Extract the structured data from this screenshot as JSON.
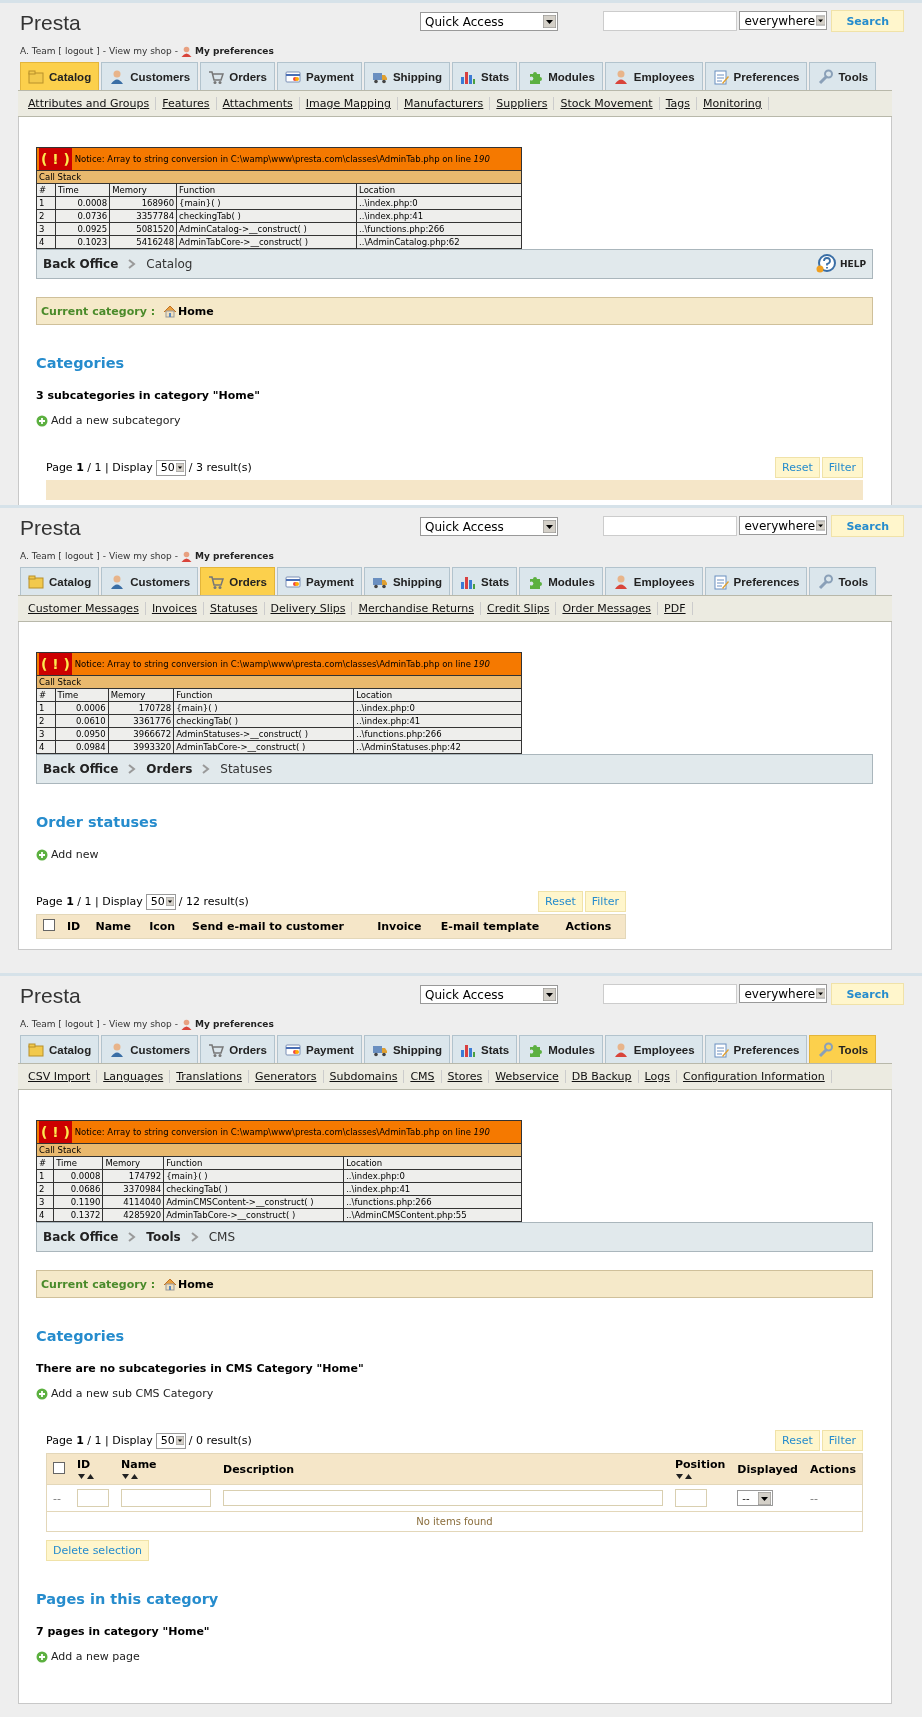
{
  "screens": [
    {
      "logo": "Presta",
      "quick_access": "Quick Access",
      "search": {
        "scope": "everywhere",
        "button": "Search"
      },
      "user": {
        "name": "A. Team [",
        "logout": "logout",
        "mid": "] -",
        "shop": "View my shop",
        "dash": "-",
        "preferences": "My preferences"
      },
      "tabs": [
        {
          "label": "Catalog",
          "selected": true
        },
        {
          "label": "Customers",
          "selected": false
        },
        {
          "label": "Orders",
          "selected": false
        },
        {
          "label": "Payment",
          "selected": false
        },
        {
          "label": "Shipping",
          "selected": false
        },
        {
          "label": "Stats",
          "selected": false
        },
        {
          "label": "Modules",
          "selected": false
        },
        {
          "label": "Employees",
          "selected": false
        },
        {
          "label": "Preferences",
          "selected": false
        },
        {
          "label": "Tools",
          "selected": false
        }
      ],
      "subtabs": [
        "Attributes and Groups",
        "Features",
        "Attachments",
        "Image Mapping",
        "Manufacturers",
        "Suppliers",
        "Stock Movement",
        "Tags",
        "Monitoring"
      ],
      "notice": {
        "icon": "( ! )",
        "message": "Notice: Array to string conversion in C:\\wamp\\www\\presta.com\\classes\\AdminTab.php on line *190*",
        "stack_title": "Call Stack",
        "columns": [
          "#",
          "Time",
          "Memory",
          "Function",
          "Location"
        ],
        "rows": [
          [
            "1",
            "0.0008",
            "168960",
            "{main}( )",
            "..\\index.php:0"
          ],
          [
            "2",
            "0.0736",
            "3357784",
            "checkingTab( )",
            "..\\index.php:41"
          ],
          [
            "3",
            "0.0925",
            "5081520",
            "AdminCatalog->__construct( )",
            "..\\functions.php:266"
          ],
          [
            "4",
            "0.1023",
            "5416248",
            "AdminTabCore->__construct( )",
            "..\\AdminCatalog.php:62"
          ]
        ]
      },
      "breadcrumb": [
        "Back Office",
        "Catalog"
      ],
      "help": "HELP",
      "current_category": {
        "label": "Current category :",
        "value": "Home"
      },
      "sections": [
        {
          "kind": "heading",
          "text": "Categories"
        },
        {
          "kind": "summary",
          "text": "3 subcategories in category \"Home\""
        },
        {
          "kind": "add_link",
          "text": "Add a new subcategory"
        },
        {
          "kind": "list",
          "page": "Page **1** / 1 | Display",
          "per_page": "50",
          "results": "/ 3 result(s)",
          "reset": "Reset",
          "filter": "Filter"
        }
      ]
    },
    {
      "logo": "Presta",
      "quick_access": "Quick Access",
      "search": {
        "scope": "everywhere",
        "button": "Search"
      },
      "user": {
        "name": "A. Team [",
        "logout": "logout",
        "mid": "] -",
        "shop": "View my shop",
        "dash": "-",
        "preferences": "My preferences"
      },
      "tabs": [
        {
          "label": "Catalog",
          "selected": false
        },
        {
          "label": "Customers",
          "selected": false
        },
        {
          "label": "Orders",
          "selected": true
        },
        {
          "label": "Payment",
          "selected": false
        },
        {
          "label": "Shipping",
          "selected": false
        },
        {
          "label": "Stats",
          "selected": false
        },
        {
          "label": "Modules",
          "selected": false
        },
        {
          "label": "Employees",
          "selected": false
        },
        {
          "label": "Preferences",
          "selected": false
        },
        {
          "label": "Tools",
          "selected": false
        }
      ],
      "subtabs": [
        "Customer Messages",
        "Invoices",
        "Statuses",
        "Delivery Slips",
        "Merchandise Returns",
        "Credit Slips",
        "Order Messages",
        "PDF"
      ],
      "notice": {
        "icon": "( ! )",
        "message": "Notice: Array to string conversion in C:\\wamp\\www\\presta.com\\classes\\AdminTab.php on line *190*",
        "stack_title": "Call Stack",
        "columns": [
          "#",
          "Time",
          "Memory",
          "Function",
          "Location"
        ],
        "rows": [
          [
            "1",
            "0.0006",
            "170728",
            "{main}( )",
            "..\\index.php:0"
          ],
          [
            "2",
            "0.0610",
            "3361776",
            "checkingTab( )",
            "..\\index.php:41"
          ],
          [
            "3",
            "0.0950",
            "3966672",
            "AdminStatuses->__construct( )",
            "..\\functions.php:266"
          ],
          [
            "4",
            "0.0984",
            "3993320",
            "AdminTabCore->__construct( )",
            "..\\AdminStatuses.php:42"
          ]
        ]
      },
      "breadcrumb": [
        "Back Office",
        "Orders",
        "Statuses"
      ],
      "sections": [
        {
          "kind": "heading",
          "text": "Order statuses"
        },
        {
          "kind": "add_link",
          "text": "Add new"
        },
        {
          "kind": "list",
          "page": "Page **1** / 1 | Display",
          "per_page": "50",
          "results": "/ 12 result(s)",
          "reset": "Reset",
          "filter": "Filter",
          "select_all_checked": false,
          "columns": [
            {
              "label": "ID",
              "sortable": false
            },
            {
              "label": "Name",
              "sortable": false
            },
            {
              "label": "Icon",
              "sortable": false
            },
            {
              "label": "Send e-mail to customer",
              "sortable": false
            },
            {
              "label": "Invoice",
              "sortable": false
            },
            {
              "label": "E-mail template",
              "sortable": false
            },
            {
              "label": "Actions",
              "sortable": false
            }
          ]
        }
      ]
    },
    {
      "logo": "Presta",
      "quick_access": "Quick Access",
      "search": {
        "scope": "everywhere",
        "button": "Search"
      },
      "user": {
        "name": "A. Team [",
        "logout": "logout",
        "mid": "] -",
        "shop": "View my shop",
        "dash": "-",
        "preferences": "My preferences"
      },
      "tabs": [
        {
          "label": "Catalog",
          "selected": false
        },
        {
          "label": "Customers",
          "selected": false
        },
        {
          "label": "Orders",
          "selected": false
        },
        {
          "label": "Payment",
          "selected": false
        },
        {
          "label": "Shipping",
          "selected": false
        },
        {
          "label": "Stats",
          "selected": false
        },
        {
          "label": "Modules",
          "selected": false
        },
        {
          "label": "Employees",
          "selected": false
        },
        {
          "label": "Preferences",
          "selected": false
        },
        {
          "label": "Tools",
          "selected": true
        }
      ],
      "subtabs": [
        "CSV Import",
        "Languages",
        "Translations",
        "Generators",
        "Subdomains",
        "CMS",
        "Stores",
        "Webservice",
        "DB Backup",
        "Logs",
        "Configuration Information"
      ],
      "notice": {
        "icon": "( ! )",
        "message": "Notice: Array to string conversion in C:\\wamp\\www\\presta.com\\classes\\AdminTab.php on line *190*",
        "stack_title": "Call Stack",
        "columns": [
          "#",
          "Time",
          "Memory",
          "Function",
          "Location"
        ],
        "rows": [
          [
            "1",
            "0.0008",
            "174792",
            "{main}( )",
            "..\\index.php:0"
          ],
          [
            "2",
            "0.0686",
            "3370984",
            "checkingTab( )",
            "..\\index.php:41"
          ],
          [
            "3",
            "0.1190",
            "4114040",
            "AdminCMSContent->__construct( )",
            "..\\functions.php:266"
          ],
          [
            "4",
            "0.1372",
            "4285920",
            "AdminTabCore->__construct( )",
            "..\\AdminCMSContent.php:55"
          ]
        ]
      },
      "breadcrumb": [
        "Back Office",
        "Tools",
        "CMS"
      ],
      "current_category": {
        "label": "Current category :",
        "value": "Home"
      },
      "sections": [
        {
          "kind": "heading",
          "text": "Categories"
        },
        {
          "kind": "summary",
          "text": "There are no subcategories in CMS Category \"Home\""
        },
        {
          "kind": "add_link",
          "text": "Add a new sub CMS Category"
        },
        {
          "kind": "list",
          "page": "Page **1** / 1 | Display",
          "per_page": "50",
          "results": "/ 0 result(s)",
          "reset": "Reset",
          "filter": "Filter",
          "select_all_checked": false,
          "columns": [
            {
              "label": "ID",
              "sortable": true
            },
            {
              "label": "Name",
              "sortable": true
            },
            {
              "label": "Description",
              "sortable": false
            },
            {
              "label": "Position",
              "sortable": true
            },
            {
              "label": "Displayed",
              "sortable": false
            },
            {
              "label": "Actions",
              "sortable": false
            }
          ],
          "filters": [
            {
              "kind": "text",
              "value": "--"
            },
            {
              "kind": "input"
            },
            {
              "kind": "input"
            },
            {
              "kind": "wide_input"
            },
            {
              "kind": "input"
            },
            {
              "kind": "select",
              "value": "--"
            },
            {
              "kind": "text",
              "value": "--"
            }
          ],
          "empty": "No items found",
          "delete": "Delete selection"
        },
        {
          "kind": "heading",
          "text": "Pages in this category"
        },
        {
          "kind": "summary",
          "text": "7 pages in category \"Home\""
        },
        {
          "kind": "add_link",
          "text": "Add a new page"
        }
      ]
    }
  ]
}
